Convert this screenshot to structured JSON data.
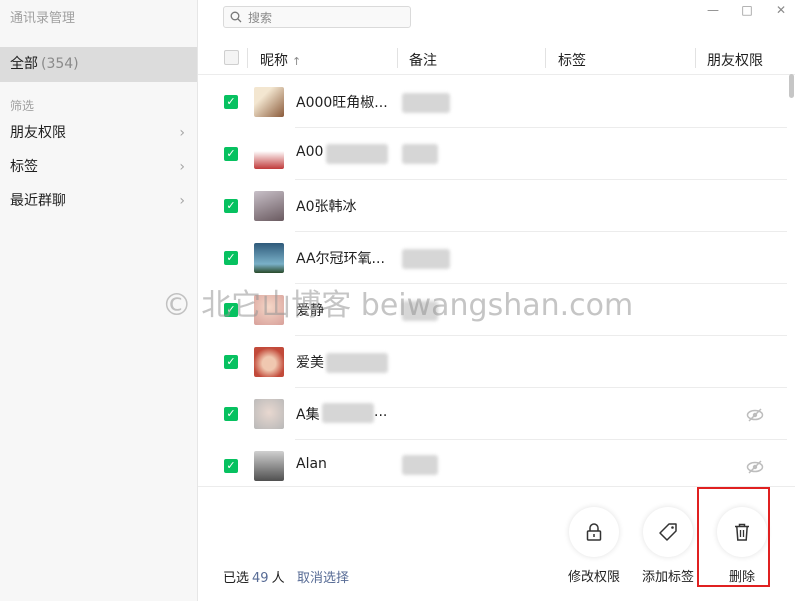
{
  "app": {
    "title": "通讯录管理"
  },
  "sidebar": {
    "all": {
      "label": "全部",
      "count": "(354)"
    },
    "filter_heading": "筛选",
    "items": [
      {
        "label": "朋友权限"
      },
      {
        "label": "标签"
      },
      {
        "label": "最近群聊"
      }
    ]
  },
  "search": {
    "placeholder": "搜索"
  },
  "window_controls": {
    "minimize": "—",
    "maximize": "□",
    "close": "✕"
  },
  "table": {
    "columns": [
      "昵称",
      "备注",
      "标签",
      "朋友权限"
    ],
    "sort_indicator": "↑",
    "rows": [
      {
        "nickname": "A000旺角椒...",
        "avatar_color": "#8a5a3a",
        "checked": true
      },
      {
        "nickname": "A00",
        "avatar_color": "#c03a3a",
        "checked": true
      },
      {
        "nickname": "A0张韩冰",
        "avatar_color": "#7a6a6a",
        "checked": true
      },
      {
        "nickname": "AA尔冠环氧...",
        "avatar_color": "#2f5a7a",
        "checked": true
      },
      {
        "nickname": "爱静",
        "avatar_color": "#d8a09a",
        "checked": true
      },
      {
        "nickname": "爱美",
        "avatar_color": "#c24a3a",
        "checked": true
      },
      {
        "nickname": "A集",
        "avatar_color": "#b8b8b8",
        "checked": true
      },
      {
        "nickname": "Alan",
        "avatar_color": "#6a6a6a",
        "checked": true
      }
    ]
  },
  "selection": {
    "prefix": "已选",
    "count": "49",
    "suffix": "人",
    "cancel": "取消选择"
  },
  "actions": [
    {
      "label": "修改权限",
      "icon": "lock-icon"
    },
    {
      "label": "添加标签",
      "icon": "tag-icon"
    },
    {
      "label": "删除",
      "icon": "trash-icon"
    }
  ],
  "watermark": "© 北它山博客 beiwangshan.com",
  "colors": {
    "check_green": "#07c160",
    "link_blue": "#576b95",
    "highlight_red": "#e02020"
  }
}
